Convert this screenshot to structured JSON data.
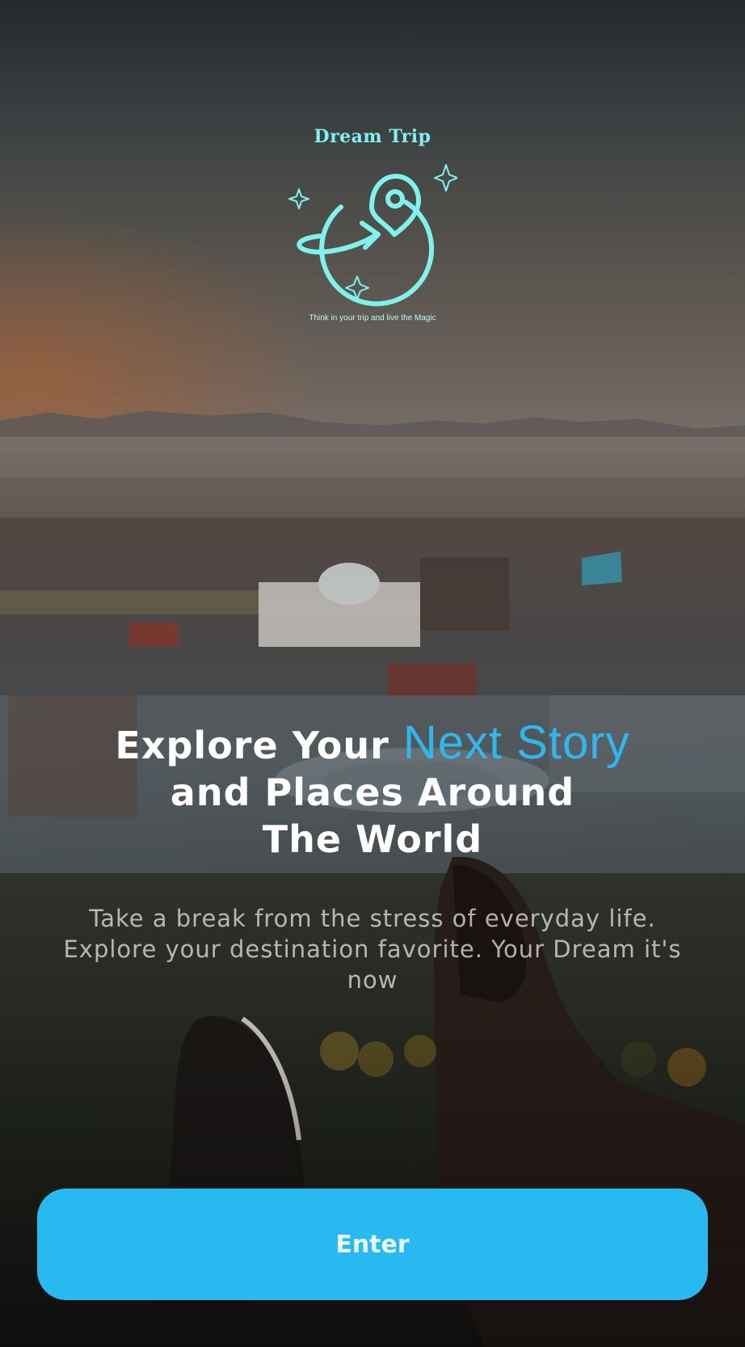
{
  "app": {
    "logo_title": "Dream Trip",
    "logo_tagline": "Think in your trip and live the Magic",
    "logo_icon": "globe-location-pin-icon"
  },
  "hero": {
    "headline_part1": "Explore Your ",
    "headline_accent": "Next Story",
    "headline_part2": "and Places Around",
    "headline_part3": "The World",
    "subtitle": "Take a break from the stress of everyday life. Explore your destination favorite. Your Dream it's now"
  },
  "actions": {
    "enter_label": "Enter"
  },
  "colors": {
    "accent": "#29b9f1",
    "logo": "#7ff2ee",
    "headline": "#ffffff"
  }
}
